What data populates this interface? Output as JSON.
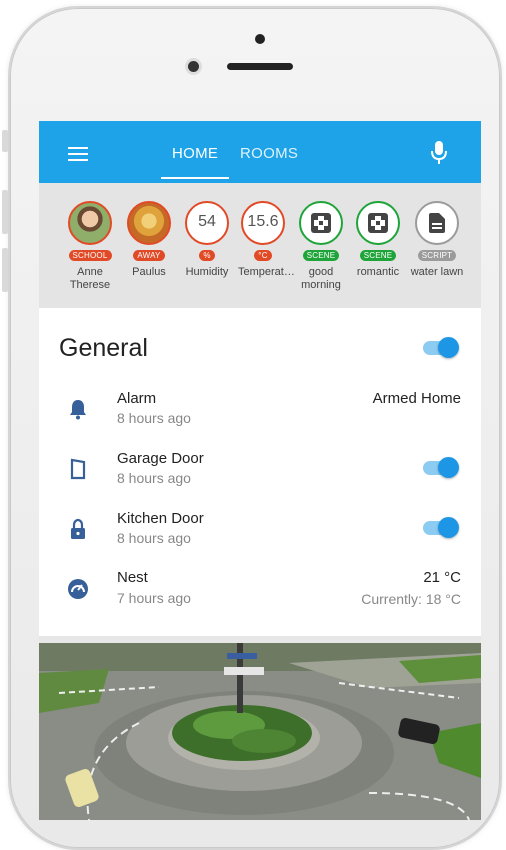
{
  "header": {
    "tabs": [
      {
        "label": "HOME",
        "active": true
      },
      {
        "label": "ROOMS",
        "active": false
      }
    ],
    "accent_color": "#1ea3e8"
  },
  "badges": [
    {
      "kind": "person",
      "tag": "SCHOOL",
      "label_line1": "Anne",
      "label_line2": "Therese",
      "color": "#e14a26"
    },
    {
      "kind": "person",
      "tag": "AWAY",
      "label_line1": "Paulus",
      "label_line2": "",
      "color": "#e14a26"
    },
    {
      "kind": "sensor",
      "value": "54",
      "tag": "%",
      "label_line1": "Humidity",
      "label_line2": "",
      "color": "#e14a26"
    },
    {
      "kind": "sensor",
      "value": "15.6",
      "tag": "°C",
      "label_line1": "Temperat…",
      "label_line2": "",
      "color": "#e14a26"
    },
    {
      "kind": "scene",
      "icon": "scene-icon",
      "tag": "SCENE",
      "label_line1": "good",
      "label_line2": "morning",
      "color": "#1fa43a"
    },
    {
      "kind": "scene",
      "icon": "scene-icon",
      "tag": "SCENE",
      "label_line1": "romantic",
      "label_line2": "",
      "color": "#1fa43a"
    },
    {
      "kind": "script",
      "icon": "script-icon",
      "tag": "SCRIPT",
      "label_line1": "water lawn",
      "label_line2": "",
      "color": "#9b9b9b"
    }
  ],
  "general": {
    "title": "General",
    "group_toggle_on": true,
    "rows": [
      {
        "name": "Alarm",
        "sub": "8 hours ago",
        "icon": "bell-icon",
        "right": "Armed Home",
        "right2": ""
      },
      {
        "name": "Garage Door",
        "sub": "8 hours ago",
        "icon": "door-icon",
        "toggle_on": true
      },
      {
        "name": "Kitchen Door",
        "sub": "8 hours ago",
        "icon": "lock-icon",
        "toggle_on": true
      },
      {
        "name": "Nest",
        "sub": "7 hours ago",
        "icon": "thermostat-icon",
        "right": "21 °C",
        "right2": "Currently: 18 °C"
      }
    ]
  }
}
